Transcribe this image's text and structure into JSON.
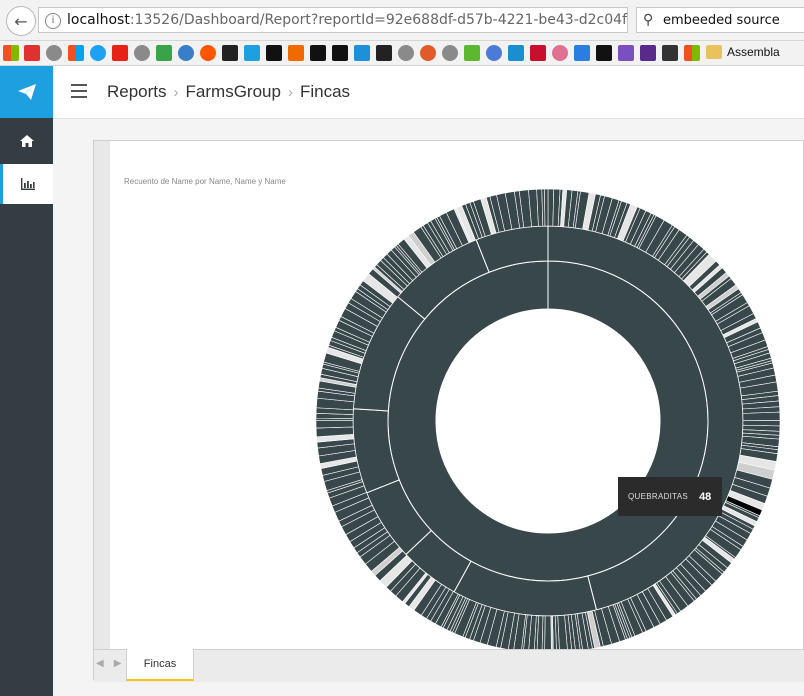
{
  "browser": {
    "url_host": "localhost",
    "url_rest": ":13526/Dashboard/Report?reportId=92e688df-d57b-4221-be43-d2c04f",
    "search_text": "embeeded source",
    "bookmark_label": "Assembla"
  },
  "breadcrumb": {
    "items": [
      "Reports",
      "FarmsGroup",
      "Fincas"
    ]
  },
  "report": {
    "subtitle": "Recuento de Name por Name, Name y Name",
    "page_tab": "Fincas"
  },
  "tooltip": {
    "label": "QUEBRADITAS",
    "value": "48"
  },
  "colors": {
    "sidebar": "#353c42",
    "accent": "#1d9fe0",
    "segment": "#37474a",
    "tab_underline": "#f2c811"
  },
  "chart_data": {
    "type": "sunburst",
    "title": "Recuento de Name por Name, Name y Name",
    "rings": [
      {
        "level": 1,
        "segments": [
          {
            "name": "",
            "share": 1.0
          }
        ]
      },
      {
        "level": 2,
        "segments": [
          {
            "share": 0.33
          },
          {
            "share": 0.13
          },
          {
            "share": 0.12
          },
          {
            "share": 0.05
          },
          {
            "share": 0.06
          },
          {
            "share": 0.07
          },
          {
            "share": 0.1
          },
          {
            "share": 0.08
          },
          {
            "share": 0.06
          }
        ]
      },
      {
        "level": 3,
        "segments_count": 260
      }
    ],
    "tooltip_category": "QUEBRADITAS",
    "tooltip_value": 48
  }
}
